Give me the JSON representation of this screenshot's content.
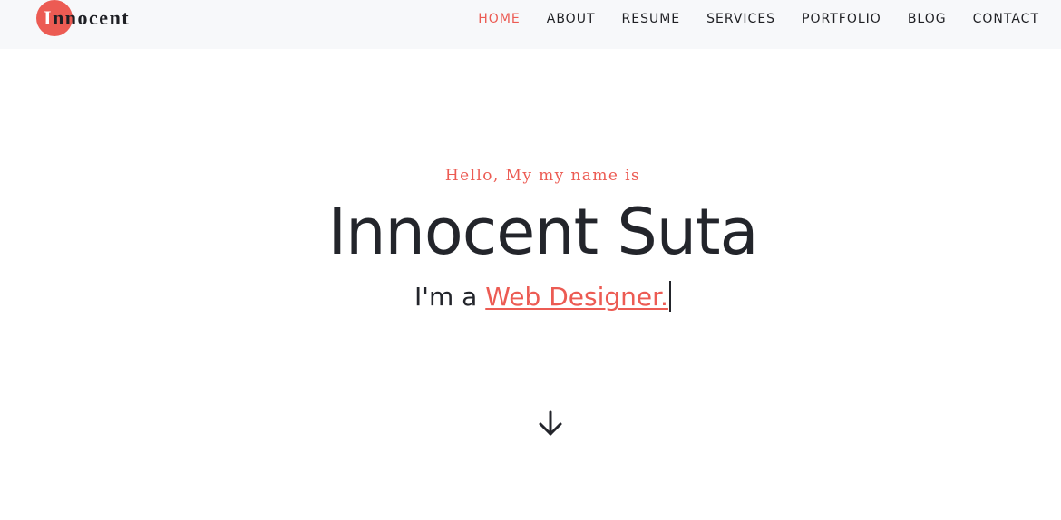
{
  "brand": {
    "first_letter": "I",
    "rest": "nnocent",
    "accent_color": "#ec5b53"
  },
  "nav": {
    "items": [
      {
        "label": "HOME",
        "active": true
      },
      {
        "label": "ABOUT",
        "active": false
      },
      {
        "label": "RESUME",
        "active": false
      },
      {
        "label": "SERVICES",
        "active": false
      },
      {
        "label": "PORTFOLIO",
        "active": false
      },
      {
        "label": "BLOG",
        "active": false
      },
      {
        "label": "CONTACT",
        "active": false
      }
    ]
  },
  "hero": {
    "greeting": "Hello, My my name is",
    "name": "Innocent Suta",
    "role_prefix": "I'm a ",
    "role_text": "Web Designer.",
    "scroll_icon": "arrow-down-icon"
  },
  "colors": {
    "accent": "#ec5b53",
    "text": "#23252b",
    "nav_background": "#f7f8fa"
  }
}
